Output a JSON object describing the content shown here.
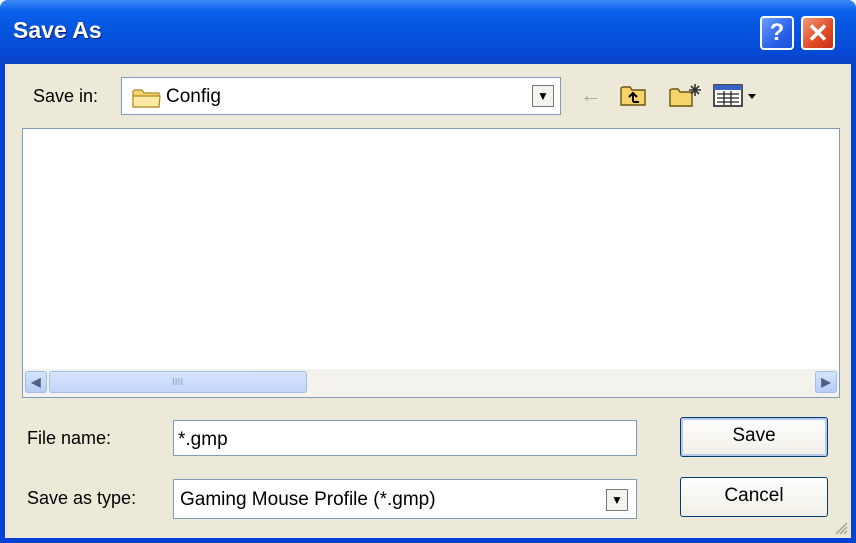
{
  "window": {
    "title": "Save As",
    "help_label": "?",
    "close_label": "✕"
  },
  "save_in": {
    "label": "Save in:",
    "value": "Config",
    "folder_icon": "folder-icon",
    "dropdown_arrow": "▼"
  },
  "toolbar": {
    "back_icon": "←",
    "up_icon": "up-one-level-icon",
    "new_folder_icon": "create-new-folder-icon",
    "view_icon": "view-menu-icon"
  },
  "scrollbar": {
    "left_arrow": "◀",
    "right_arrow": "▶",
    "grip": "IIII"
  },
  "file_name": {
    "label": "File name:",
    "value": "*.gmp"
  },
  "save_as_type": {
    "label": "Save as type:",
    "value": "Gaming Mouse Profile (*.gmp)",
    "dropdown_arrow": "▼"
  },
  "buttons": {
    "save": "Save",
    "cancel": "Cancel"
  },
  "colors": {
    "titlebar": "#0453dc",
    "dialog_bg": "#ece9d8",
    "close": "#e04a25",
    "accent": "#3d8bf6"
  }
}
